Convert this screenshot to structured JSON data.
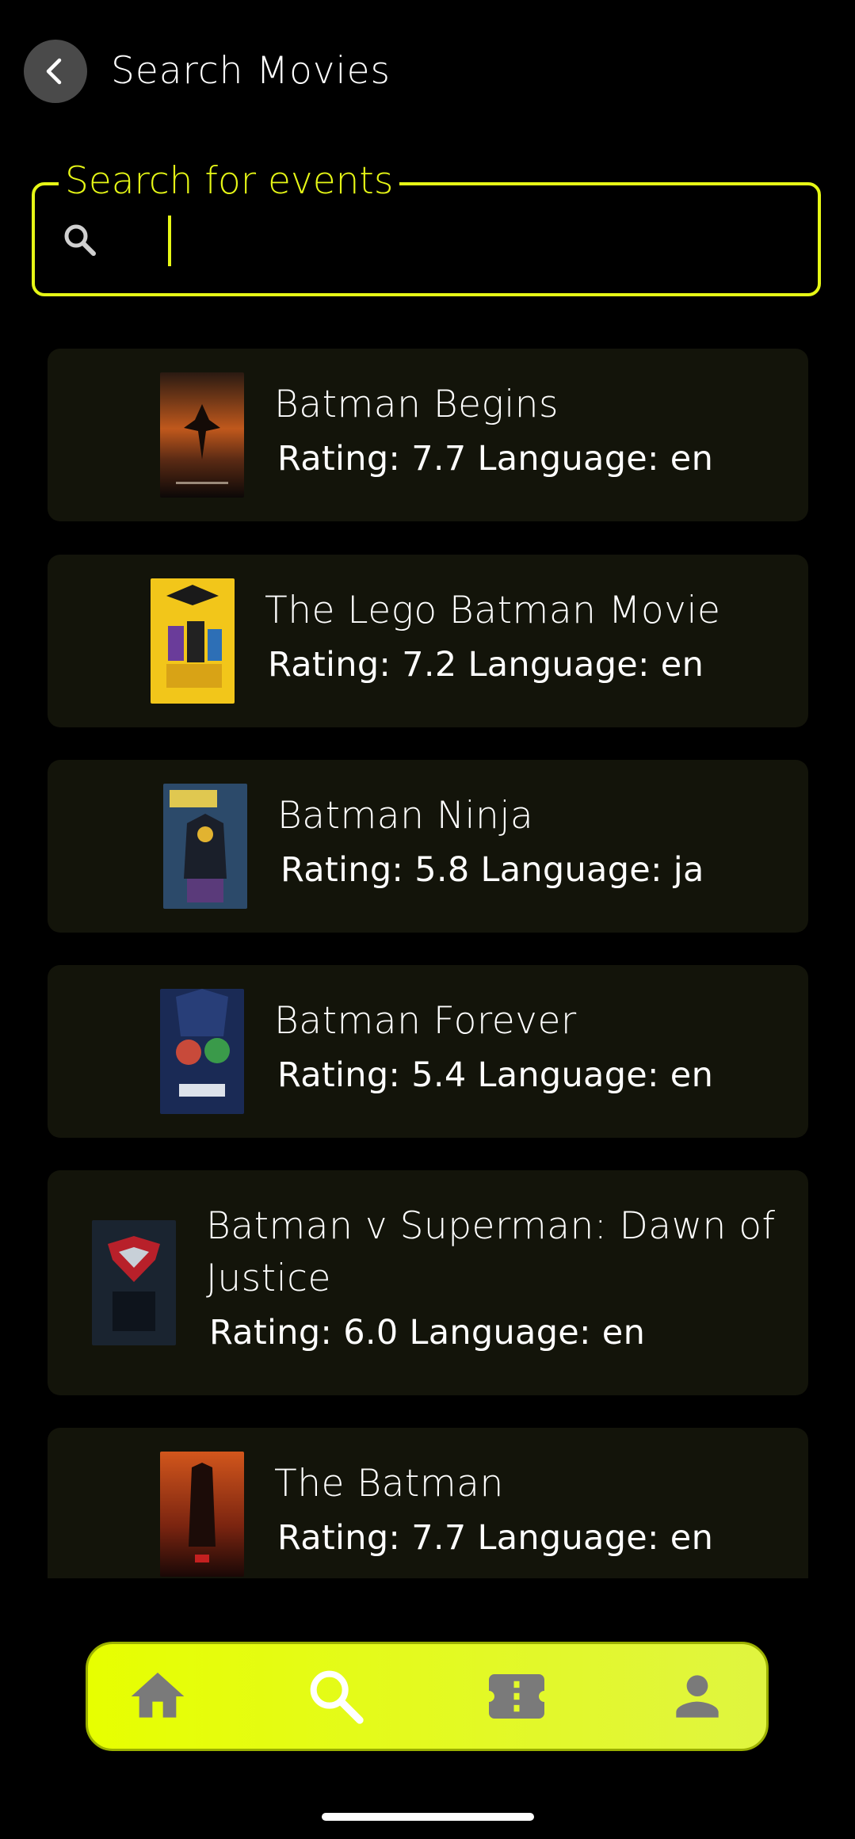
{
  "header": {
    "title": "Search Movies",
    "back_icon": "chevron-left-icon"
  },
  "search": {
    "label": "Search for events",
    "value": "",
    "icon": "search-icon",
    "accent_color": "#e6f716"
  },
  "movies": [
    {
      "title": "Batman Begins",
      "meta": "Rating: 7.7 Language: en"
    },
    {
      "title": "The Lego Batman Movie",
      "meta": "Rating: 7.2 Language: en"
    },
    {
      "title": "Batman Ninja",
      "meta": "Rating: 5.8 Language: ja"
    },
    {
      "title": "Batman Forever",
      "meta": "Rating: 5.4 Language: en"
    },
    {
      "title": "Batman v Superman: Dawn of Justice",
      "meta": "Rating: 6.0 Language: en"
    },
    {
      "title": "The Batman",
      "meta": "Rating: 7.7 Language: en"
    }
  ],
  "bottom_nav": {
    "items": [
      {
        "icon": "home-icon",
        "active": false
      },
      {
        "icon": "search-icon",
        "active": true
      },
      {
        "icon": "ticket-icon",
        "active": false
      },
      {
        "icon": "person-icon",
        "active": false
      }
    ],
    "background": "#e7ff00",
    "inactive_icon_color": "#7a7a7a",
    "active_icon_color": "#ffffff"
  }
}
